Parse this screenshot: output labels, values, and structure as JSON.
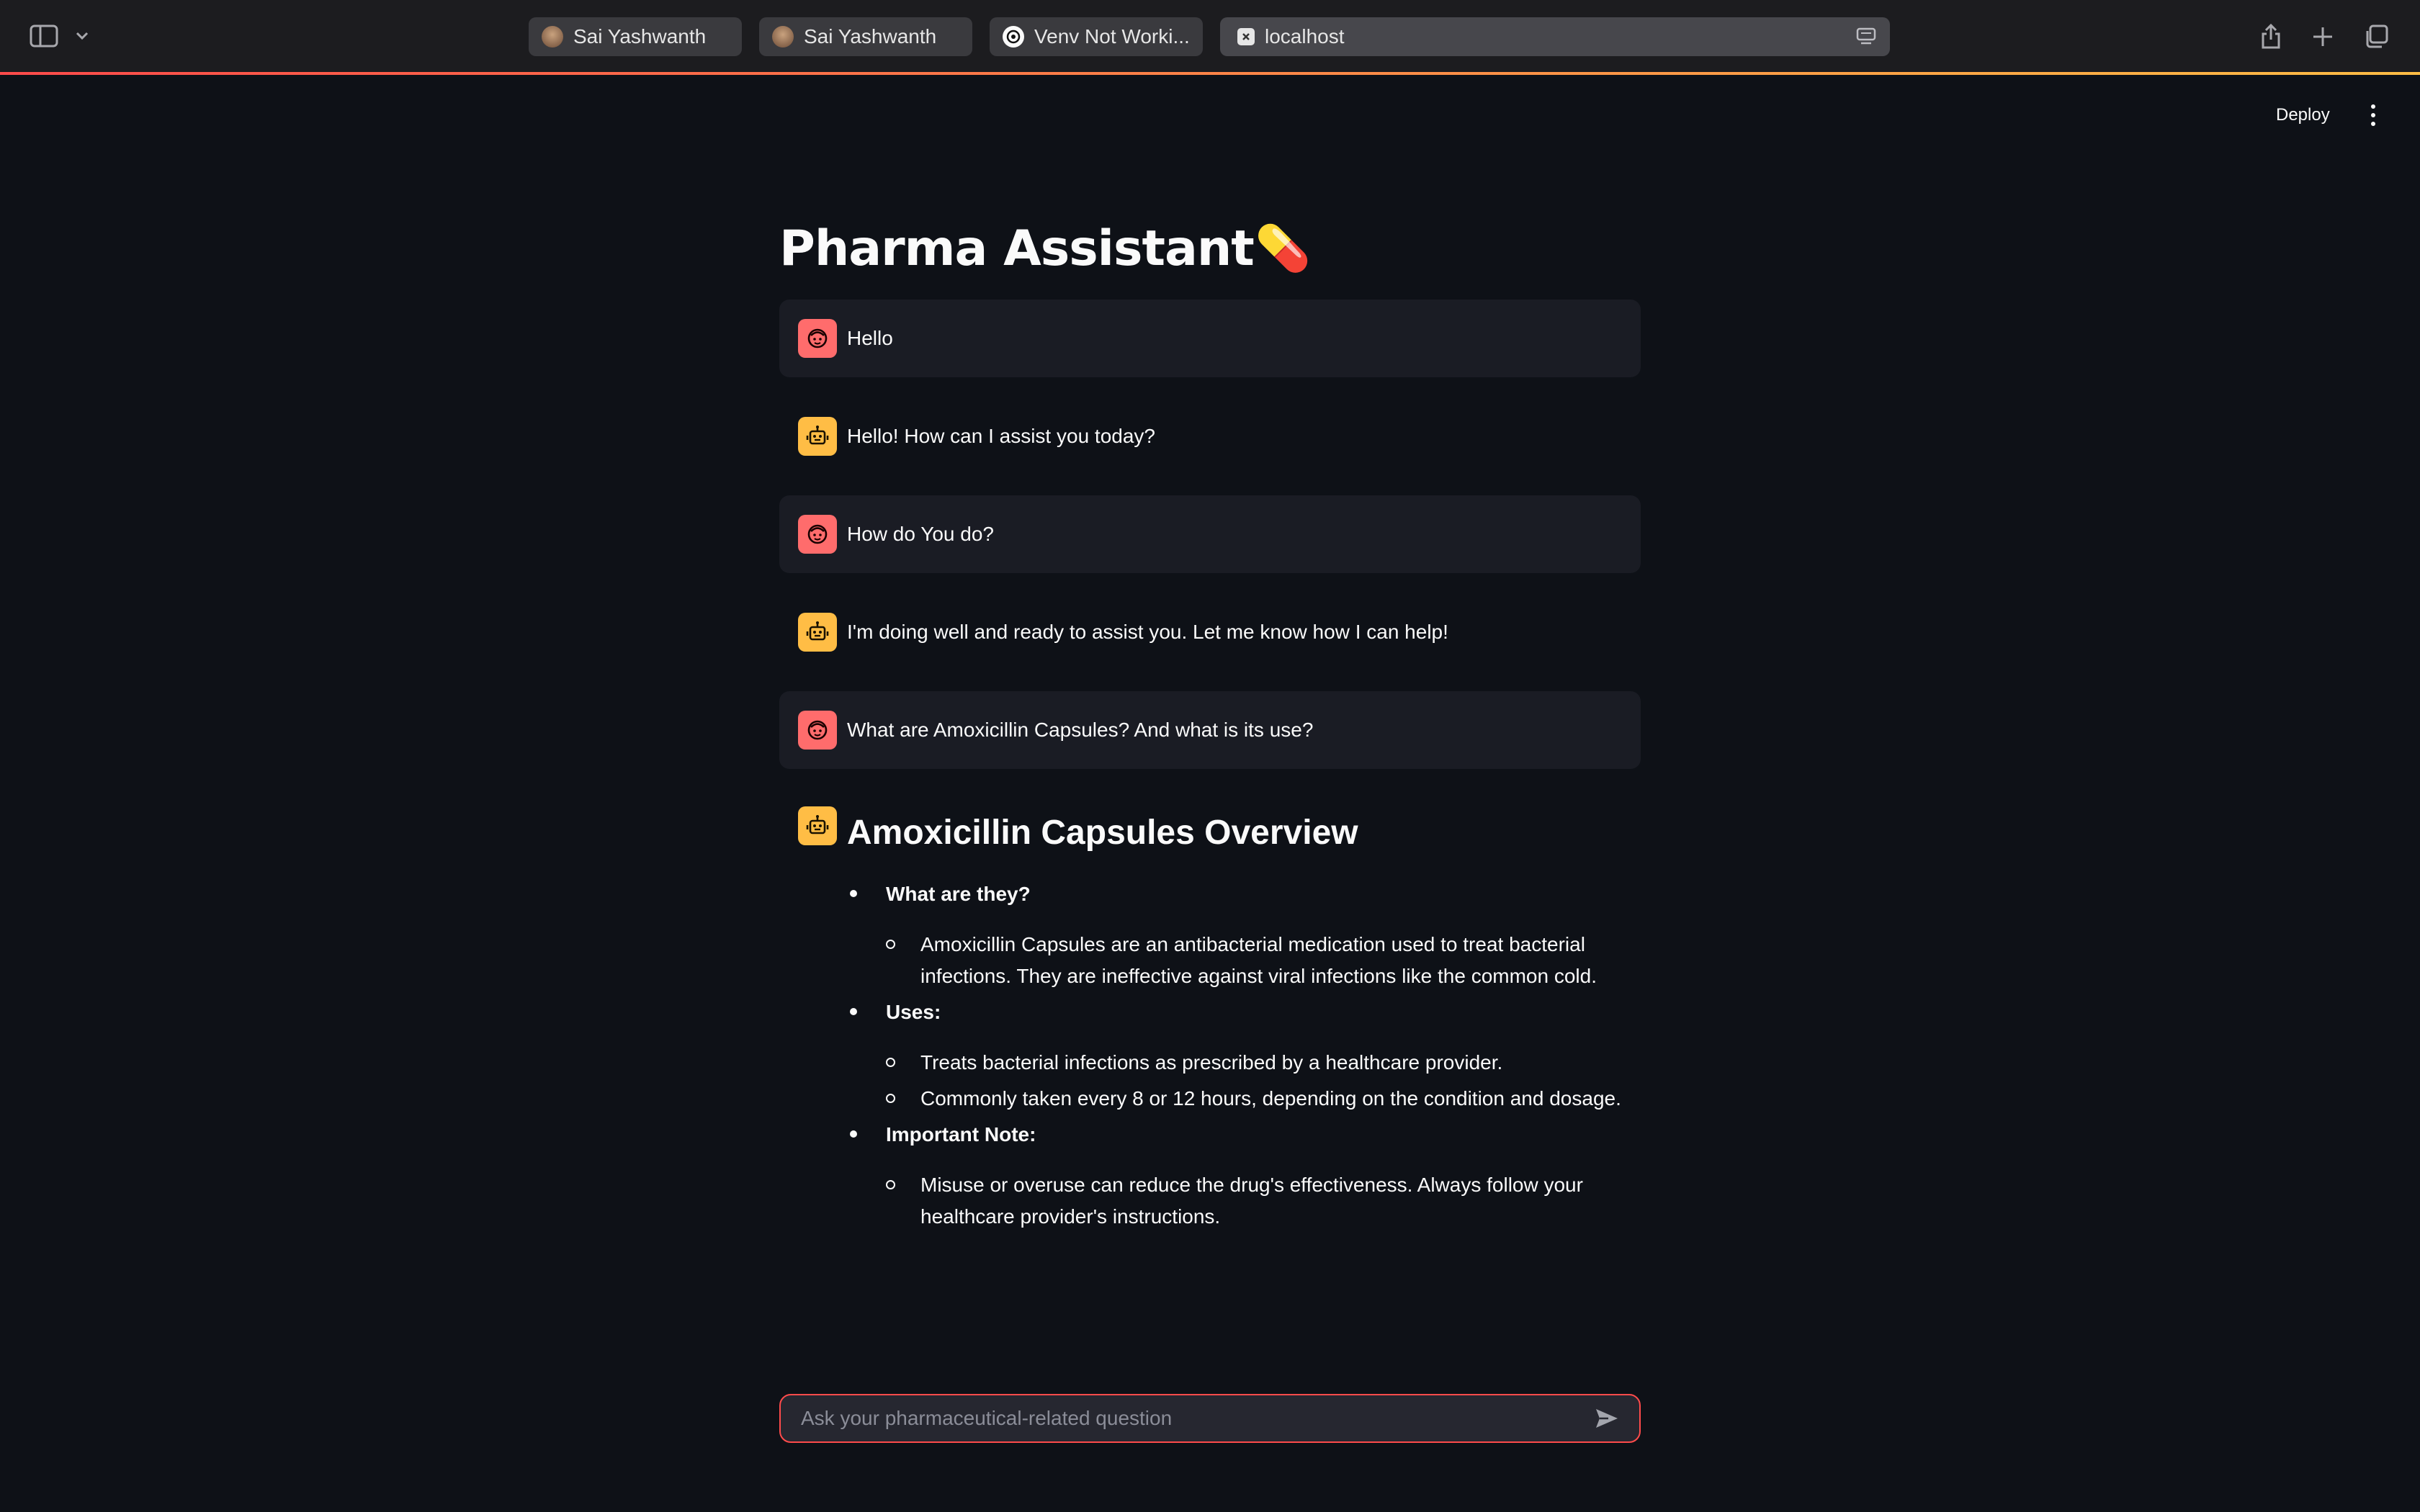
{
  "browser": {
    "tabs": [
      {
        "label": "Sai Yashwanth",
        "favicon": "avatar-favicon",
        "active": false
      },
      {
        "label": "Sai Yashwanth",
        "favicon": "avatar-favicon",
        "active": false
      },
      {
        "label": "Venv Not Worki...",
        "favicon": "openai-favicon",
        "active": false
      },
      {
        "label": "localhost",
        "favicon": "close-favicon",
        "active": true
      }
    ]
  },
  "header": {
    "deploy_label": "Deploy"
  },
  "app": {
    "title": "Pharma Assistant",
    "title_emoji": "💊"
  },
  "messages": [
    {
      "role": "user",
      "text": "Hello"
    },
    {
      "role": "assistant",
      "text": "Hello! How can I assist you today?"
    },
    {
      "role": "user",
      "text": "How do You do?"
    },
    {
      "role": "assistant",
      "text": "I'm doing well and ready to assist you. Let me know how I can help!"
    },
    {
      "role": "user",
      "text": "What are Amoxicillin Capsules? And what is its use?"
    }
  ],
  "answer": {
    "heading": "Amoxicillin Capsules Overview",
    "sections": [
      {
        "label": "What are they?",
        "items": [
          "Amoxicillin Capsules are an antibacterial medication used to treat bacterial infections. They are ineffective against viral infections like the common cold."
        ]
      },
      {
        "label": "Uses:",
        "items": [
          "Treats bacterial infections as prescribed by a healthcare provider.",
          "Commonly taken every 8 or 12 hours, depending on the condition and dosage."
        ]
      },
      {
        "label": "Important Note:",
        "items": [
          "Misuse or overuse can reduce the drug's effectiveness. Always follow your healthcare provider's instructions."
        ]
      }
    ]
  },
  "chat_input": {
    "placeholder": "Ask your pharmaceutical-related question"
  },
  "colors": {
    "accent": "#ff4b4b",
    "user_avatar": "#ff6c6c",
    "bot_avatar": "#ffbd45",
    "background": "#0e1117"
  }
}
